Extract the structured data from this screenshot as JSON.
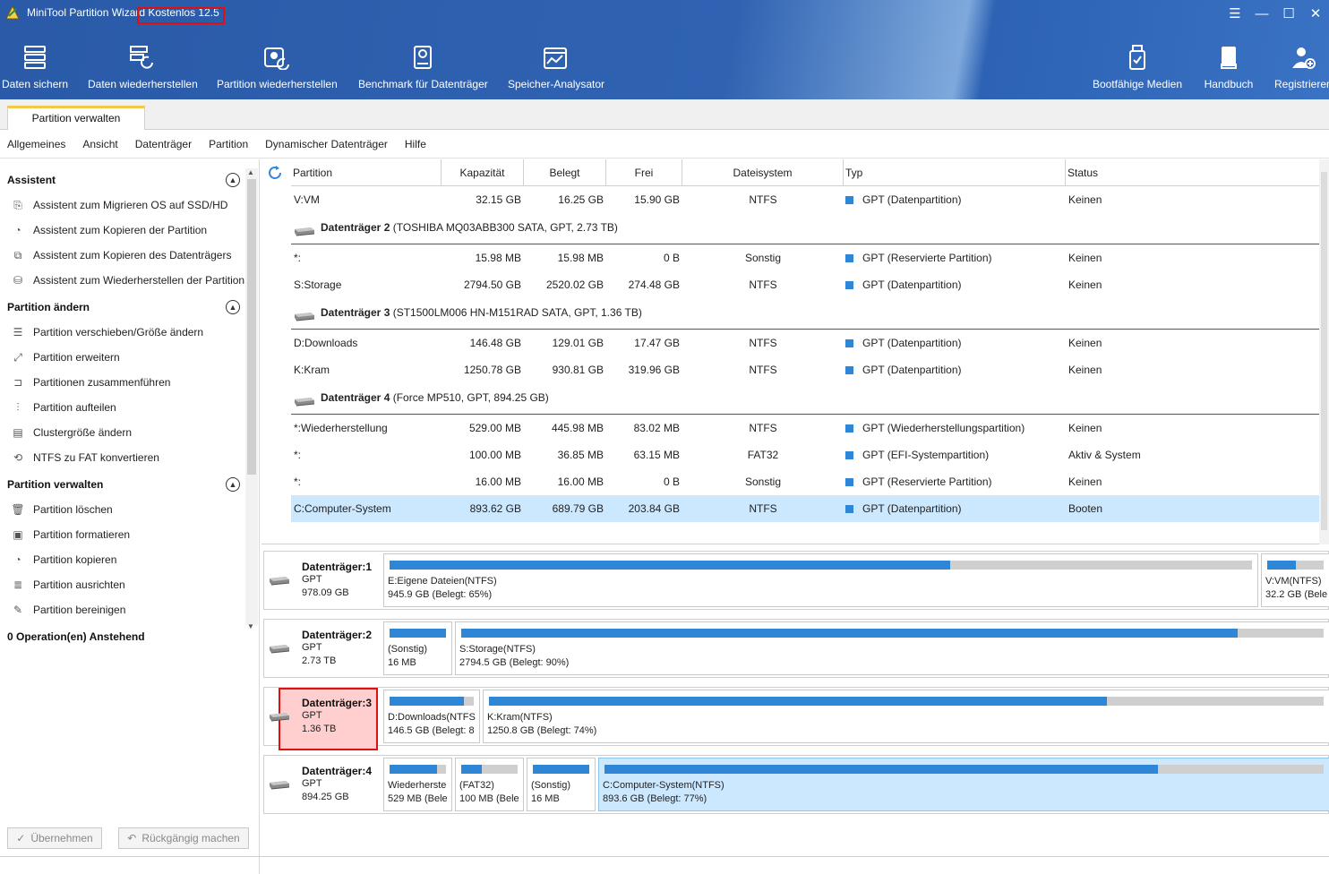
{
  "app": {
    "title": "MiniTool Partition Wizard Kostenlos 12.5"
  },
  "window_controls": {
    "menu": "☰",
    "minimize": "—",
    "maximize": "☐",
    "close": "✕"
  },
  "toolbar": {
    "left": [
      {
        "label": "Daten sichern",
        "icon": "backup-icon"
      },
      {
        "label": "Daten wiederherstellen",
        "icon": "data-recovery-icon"
      },
      {
        "label": "Partition wiederherstellen",
        "icon": "partition-recovery-icon"
      },
      {
        "label": "Benchmark für Datenträger",
        "icon": "benchmark-icon"
      },
      {
        "label": "Speicher-Analysator",
        "icon": "space-analyzer-icon"
      }
    ],
    "right": [
      {
        "label": "Bootfähige Medien",
        "icon": "bootable-media-icon"
      },
      {
        "label": "Handbuch",
        "icon": "manual-icon"
      },
      {
        "label": "Registrieren",
        "icon": "register-icon"
      }
    ]
  },
  "tabs": {
    "active": "Partition verwalten"
  },
  "menu": [
    "Allgemeines",
    "Ansicht",
    "Datenträger",
    "Partition",
    "Dynamischer Datenträger",
    "Hilfe"
  ],
  "sidebar": {
    "sections": [
      {
        "title": "Assistent",
        "items": [
          "Assistent zum Migrieren OS auf SSD/HD",
          "Assistent zum Kopieren der Partition",
          "Assistent zum Kopieren des Datenträgers",
          "Assistent zum Wiederherstellen der Partition"
        ]
      },
      {
        "title": "Partition ändern",
        "items": [
          "Partition verschieben/Größe ändern",
          "Partition erweitern",
          "Partitionen zusammenführen",
          "Partition aufteilen",
          "Clustergröße ändern",
          "NTFS zu FAT konvertieren"
        ]
      },
      {
        "title": "Partition verwalten",
        "items": [
          "Partition löschen",
          "Partition formatieren",
          "Partition kopieren",
          "Partition ausrichten",
          "Partition bereinigen"
        ]
      }
    ],
    "pending": "0 Operation(en) Anstehend",
    "apply": "Übernehmen",
    "undo": "Rückgängig machen"
  },
  "table": {
    "columns": [
      "Partition",
      "Kapazität",
      "Belegt",
      "Frei",
      "Dateisystem",
      "Typ",
      "Status"
    ],
    "rows": [
      {
        "kind": "part",
        "partition": "V:VM",
        "cap": "32.15 GB",
        "used": "16.25 GB",
        "free": "15.90 GB",
        "fs": "NTFS",
        "type": "GPT (Datenpartition)",
        "status": "Keinen"
      },
      {
        "kind": "disk",
        "name": "Datenträger 2",
        "detail": "(TOSHIBA MQ03ABB300 SATA, GPT, 2.73 TB)"
      },
      {
        "kind": "part",
        "partition": "*:",
        "cap": "15.98 MB",
        "used": "15.98 MB",
        "free": "0 B",
        "fs": "Sonstig",
        "type": "GPT (Reservierte Partition)",
        "status": "Keinen"
      },
      {
        "kind": "part",
        "partition": "S:Storage",
        "cap": "2794.50 GB",
        "used": "2520.02 GB",
        "free": "274.48 GB",
        "fs": "NTFS",
        "type": "GPT (Datenpartition)",
        "status": "Keinen"
      },
      {
        "kind": "disk",
        "name": "Datenträger 3",
        "detail": "(ST1500LM006 HN-M151RAD SATA, GPT, 1.36 TB)"
      },
      {
        "kind": "part",
        "partition": "D:Downloads",
        "cap": "146.48 GB",
        "used": "129.01 GB",
        "free": "17.47 GB",
        "fs": "NTFS",
        "type": "GPT (Datenpartition)",
        "status": "Keinen"
      },
      {
        "kind": "part",
        "partition": "K:Kram",
        "cap": "1250.78 GB",
        "used": "930.81 GB",
        "free": "319.96 GB",
        "fs": "NTFS",
        "type": "GPT (Datenpartition)",
        "status": "Keinen"
      },
      {
        "kind": "disk",
        "name": "Datenträger 4",
        "detail": "(Force MP510, GPT, 894.25 GB)"
      },
      {
        "kind": "part",
        "partition": "*:Wiederherstellung",
        "cap": "529.00 MB",
        "used": "445.98 MB",
        "free": "83.02 MB",
        "fs": "NTFS",
        "type": "GPT (Wiederherstellungspartition)",
        "status": "Keinen"
      },
      {
        "kind": "part",
        "partition": "*:",
        "cap": "100.00 MB",
        "used": "36.85 MB",
        "free": "63.15 MB",
        "fs": "FAT32",
        "type": "GPT (EFI-Systempartition)",
        "status": "Aktiv & System"
      },
      {
        "kind": "part",
        "partition": "*:",
        "cap": "16.00 MB",
        "used": "16.00 MB",
        "free": "0 B",
        "fs": "Sonstig",
        "type": "GPT (Reservierte Partition)",
        "status": "Keinen"
      },
      {
        "kind": "part",
        "partition": "C:Computer-System",
        "cap": "893.62 GB",
        "used": "689.79 GB",
        "free": "203.84 GB",
        "fs": "NTFS",
        "type": "GPT (Datenpartition)",
        "status": "Booten",
        "selected": true
      }
    ]
  },
  "disk_map": [
    {
      "name": "Datenträger:1",
      "style": "GPT",
      "size": "978.09 GB",
      "highlighted": false,
      "partitions": [
        {
          "l1": "E:Eigene Dateien(NTFS)",
          "l2": "945.9 GB (Belegt: 65%)",
          "used_fraction": 0.65
        },
        {
          "l1": "V:VM(NTFS)",
          "l2": "32.2 GB (Bele",
          "used_fraction": 0.5
        }
      ]
    },
    {
      "name": "Datenträger:2",
      "style": "GPT",
      "size": "2.73 TB",
      "highlighted": false,
      "partitions": [
        {
          "l1": "(Sonstig)",
          "l2": "16 MB",
          "used_fraction": 1.0
        },
        {
          "l1": "S:Storage(NTFS)",
          "l2": "2794.5 GB (Belegt: 90%)",
          "used_fraction": 0.9
        }
      ]
    },
    {
      "name": "Datenträger:3",
      "style": "GPT",
      "size": "1.36 TB",
      "highlighted": true,
      "partitions": [
        {
          "l1": "D:Downloads(NTFS",
          "l2": "146.5 GB (Belegt: 8",
          "used_fraction": 0.88
        },
        {
          "l1": "K:Kram(NTFS)",
          "l2": "1250.8 GB (Belegt: 74%)",
          "used_fraction": 0.74
        }
      ]
    },
    {
      "name": "Datenträger:4",
      "style": "GPT",
      "size": "894.25 GB",
      "highlighted": false,
      "partitions": [
        {
          "l1": "Wiederherste",
          "l2": "529 MB (Bele",
          "used_fraction": 0.84
        },
        {
          "l1": "(FAT32)",
          "l2": "100 MB (Bele",
          "used_fraction": 0.37
        },
        {
          "l1": "(Sonstig)",
          "l2": "16 MB",
          "used_fraction": 1.0
        },
        {
          "l1": "C:Computer-System(NTFS)",
          "l2": "893.6 GB (Belegt: 77%)",
          "used_fraction": 0.77,
          "selected": true
        }
      ]
    }
  ],
  "colors": {
    "accent": "#2f86d6",
    "header": "#2f63b2",
    "selection": "#cce8ff",
    "highlight_border": "#e01010"
  }
}
